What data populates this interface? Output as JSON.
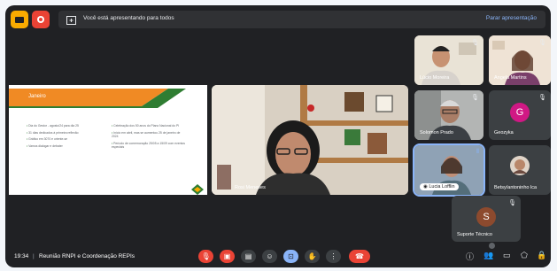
{
  "presenting_bar": {
    "message": "Você está apresentando para todos",
    "stop_label": "Parar apresentação"
  },
  "slide": {
    "title": "Janeiro",
    "left_bullets": [
      "Dia do Gestor - agosto/24 para dia 25",
      "31 dias dedicados à primeira reflexão",
      "Gráfico em 3070 e oriente-se",
      "Vamos dialogar e debater"
    ],
    "right_bullets": [
      "Celebração dos 50 anos do Plano Nacional do PI",
      "Início em abril, mas se aumentou 25 de janeiro de 2024",
      "Período de comemoração 25/05 a 15/09 com eventos especiais"
    ]
  },
  "tiles": {
    "main_speaker": "Rosi Meneses",
    "p1": "Lúcio Moreira",
    "p2": "Angela Martins",
    "p3": "Solomon Prado",
    "p4": "Geozyka",
    "p4_initial": "G",
    "p5": "Lucia Lofflin",
    "p6": "Betsy/antoninho lca",
    "p7": "Suporte Técnico",
    "p7_initial": "S"
  },
  "bottom": {
    "time": "19:34",
    "meeting_title": "Reunião RNPI e Coordenação REPIs"
  },
  "icons": [
    "mic-off-icon",
    "camera-off-icon",
    "captions-icon",
    "emoji-icon",
    "present-icon",
    "hand-icon",
    "more-icon",
    "end-call-icon",
    "info-icon",
    "people-icon",
    "chat-icon",
    "activities-icon",
    "lock-icon"
  ],
  "colors": {
    "end_call": "#ea4335",
    "present_active": "#8ab4f8",
    "slide_orange": "#f08a24",
    "slide_green": "#2f7d32"
  }
}
